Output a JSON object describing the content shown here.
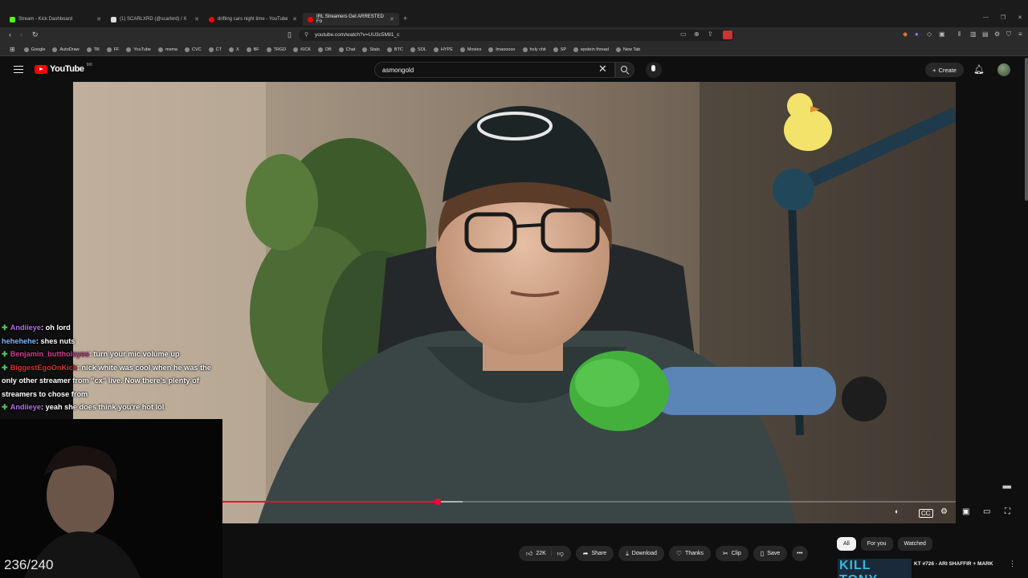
{
  "browser": {
    "tabs": [
      {
        "label": "Stream - Kick Dashboard",
        "fav": "#53fc18"
      },
      {
        "label": "(1) SCARLXRD (@scarlxrd) / X",
        "fav": "#dddddd"
      },
      {
        "label": "drifting cars night time - YouTube",
        "fav": "#ff0000"
      },
      {
        "label": "IRL Streamers Get ARRESTED Fo",
        "fav": "#ff0000"
      }
    ],
    "url": "youtube.com/watch?v=UU3c5Mil1_c",
    "bookmarks": [
      "Google",
      "AutoDraw",
      "Tlll",
      "FF",
      "YouTube",
      "msma",
      "CVC",
      "CT",
      "X",
      "BF",
      "TRGD",
      "KICK",
      "DB",
      "Chat",
      "Stats",
      "BTC",
      "SOL",
      "HYPE",
      "Movies",
      "lmaooooo",
      "holy chit",
      "SP",
      "epstein thread",
      "New Tab"
    ]
  },
  "youtube": {
    "logo": "YouTube",
    "country": "MX",
    "search_value": "asmongold",
    "create_label": "Create"
  },
  "player": {
    "progress_fraction": 0.294,
    "buffered_fraction": 0.327
  },
  "actions": {
    "like_count": "22K",
    "share": "Share",
    "download": "Download",
    "thanks": "Thanks",
    "clip": "Clip",
    "save": "Save"
  },
  "chips": [
    "All",
    "For you",
    "Watched"
  ],
  "recommendation": {
    "thumb_text": "KILL TONY",
    "title": "KT #726 - ARI SHAFFIR + MARK"
  },
  "chat": [
    {
      "user": "Andiieye",
      "color": "#b06cf0",
      "msg": ": oh lord"
    },
    {
      "user": "hehehehe",
      "color": "#7fb6ff",
      "msg": ": shes nuts"
    },
    {
      "user": "Benjamin_buttholeyes",
      "color": "#d43b91",
      "msg": ": turn your mic volume up"
    },
    {
      "user": "BiggestEgoOnKick",
      "color": "#e22b2b",
      "msg": ": nick white was cool when he was the only other streamer from \"cx\" live. Now there's plenty of streamers to chose from"
    },
    {
      "user": "Andiieye",
      "color": "#b06cf0",
      "msg": ": yeah she does think you're hot lol"
    }
  ],
  "overlay": {
    "counter": "236/240"
  },
  "colors": {
    "accent": "#ff0033",
    "kick_green": "#53fc18"
  }
}
